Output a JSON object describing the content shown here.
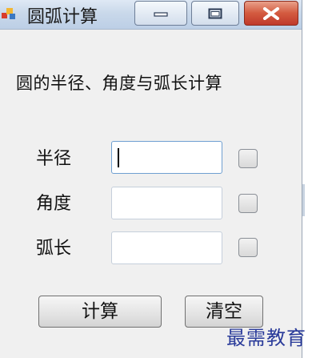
{
  "window": {
    "title": "圆弧计算",
    "app_icon": "app-icon"
  },
  "caption_buttons": {
    "minimize_icon": "minimize-icon",
    "maximize_icon": "maximize-icon",
    "close_icon": "close-icon"
  },
  "form": {
    "description": "圆的半径、角度与弧长计算",
    "fields": [
      {
        "label": "半径",
        "value": "",
        "focused": true,
        "checked": false
      },
      {
        "label": "角度",
        "value": "",
        "focused": false,
        "checked": false
      },
      {
        "label": "弧长",
        "value": "",
        "focused": false,
        "checked": false
      }
    ],
    "buttons": {
      "calculate": "计算",
      "clear": "清空"
    }
  },
  "watermark": "最需教育",
  "colors": {
    "close_button": "#c0392b",
    "watermark": "#2a3b9a",
    "focus_border": "#6f9fd1"
  }
}
